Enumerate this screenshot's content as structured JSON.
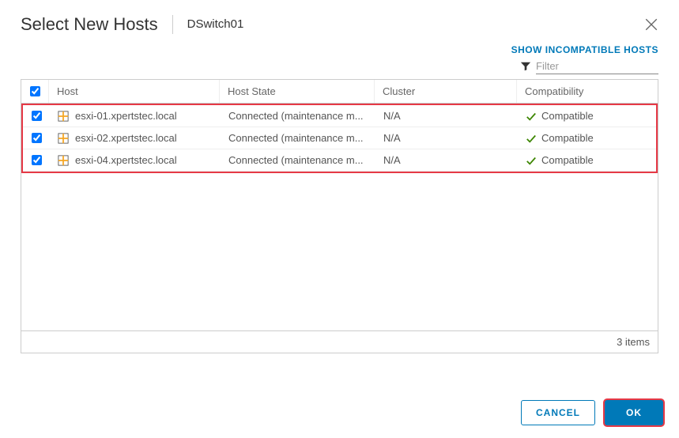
{
  "header": {
    "title": "Select New Hosts",
    "subtitle": "DSwitch01"
  },
  "link_show_incompatible": "SHOW INCOMPATIBLE HOSTS",
  "filter": {
    "placeholder": "Filter",
    "value": ""
  },
  "columns": {
    "host": "Host",
    "state": "Host State",
    "cluster": "Cluster",
    "compat": "Compatibility"
  },
  "rows": [
    {
      "checked": true,
      "host": "esxi-01.xpertstec.local",
      "state": "Connected (maintenance m...",
      "cluster": "N/A",
      "compat": "Compatible"
    },
    {
      "checked": true,
      "host": "esxi-02.xpertstec.local",
      "state": "Connected (maintenance m...",
      "cluster": "N/A",
      "compat": "Compatible"
    },
    {
      "checked": true,
      "host": "esxi-04.xpertstec.local",
      "state": "Connected (maintenance m...",
      "cluster": "N/A",
      "compat": "Compatible"
    }
  ],
  "footer_items": "3 items",
  "buttons": {
    "cancel": "CANCEL",
    "ok": "OK"
  },
  "colors": {
    "accent": "#0079b8",
    "highlight": "#e63946",
    "ok": "#3c8500"
  }
}
